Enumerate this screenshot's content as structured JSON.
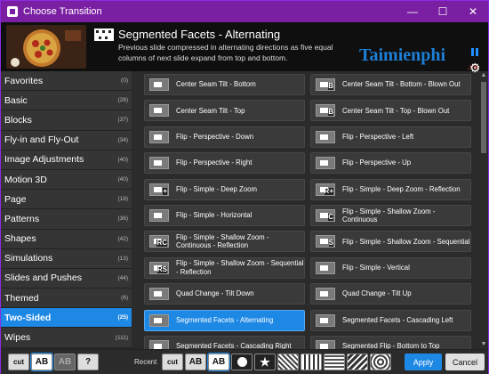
{
  "window": {
    "title": "Choose Transition",
    "minimize": "—",
    "maximize": "☐",
    "close": "✕"
  },
  "header": {
    "name": "Segmented Facets - Alternating",
    "description": "Previous slide compressed in alternating directions as five equal columns of next slide expand from top and bottom.",
    "watermark_brand": "Taimienphi",
    "watermark_tld": ".vn"
  },
  "sidebar": {
    "items": [
      {
        "label": "Favorites",
        "count": "(0)"
      },
      {
        "label": "Basic",
        "count": "(28)"
      },
      {
        "label": "Blocks",
        "count": "(37)"
      },
      {
        "label": "Fly-in and Fly-Out",
        "count": "(34)"
      },
      {
        "label": "Image Adjustments",
        "count": "(40)"
      },
      {
        "label": "Motion 3D",
        "count": "(40)"
      },
      {
        "label": "Page",
        "count": "(18)"
      },
      {
        "label": "Patterns",
        "count": "(36)"
      },
      {
        "label": "Shapes",
        "count": "(42)"
      },
      {
        "label": "Simulations",
        "count": "(13)"
      },
      {
        "label": "Slides and Pushes",
        "count": "(44)"
      },
      {
        "label": "Themed",
        "count": "(6)"
      },
      {
        "label": "Two-Sided",
        "count": "(25)",
        "selected": true
      },
      {
        "label": "Wipes",
        "count": "(111)"
      }
    ]
  },
  "transitions": [
    {
      "label": "Center Seam Tilt - Bottom",
      "badge": ""
    },
    {
      "label": "Center Seam Tilt - Bottom - Blown Out",
      "badge": "B"
    },
    {
      "label": "Center Seam Tilt - Top",
      "badge": ""
    },
    {
      "label": "Center Seam Tilt - Top - Blown Out",
      "badge": "B"
    },
    {
      "label": "Flip - Perspective - Down",
      "badge": ""
    },
    {
      "label": "Flip - Perspective - Left",
      "badge": ""
    },
    {
      "label": "Flip - Perspective - Right",
      "badge": ""
    },
    {
      "label": "Flip - Perspective - Up",
      "badge": ""
    },
    {
      "label": "Flip - Simple - Deep Zoom",
      "badge": "+"
    },
    {
      "label": "Flip - Simple - Deep Zoom - Reflection",
      "badge": "R+"
    },
    {
      "label": "Flip - Simple - Horizontal",
      "badge": ""
    },
    {
      "label": "Flip - Simple - Shallow Zoom - Continuous",
      "badge": "C"
    },
    {
      "label": "Flip - Simple - Shallow Zoom - Continuous - Reflection",
      "badge": "RC"
    },
    {
      "label": "Flip - Simple - Shallow Zoom - Sequential",
      "badge": "S"
    },
    {
      "label": "Flip - Simple - Shallow Zoom - Sequential - Reflection",
      "badge": "RS"
    },
    {
      "label": "Flip - Simple - Vertical",
      "badge": ""
    },
    {
      "label": "Quad Change - Tilt Down",
      "badge": ""
    },
    {
      "label": "Quad Change - Tilt Up",
      "badge": ""
    },
    {
      "label": "Segmented Facets - Alternating",
      "badge": "",
      "selected": true
    },
    {
      "label": "Segmented Facets - Cascading Left",
      "badge": ""
    },
    {
      "label": "Segmented Facets - Cascading Right",
      "badge": ""
    },
    {
      "label": "Segmented Flip - Bottom to Top",
      "badge": ""
    }
  ],
  "footer": {
    "mode_buttons": [
      "cut",
      "AB",
      "AB",
      "?"
    ],
    "recent_label": "Recent",
    "recent_buttons": [
      "cut",
      "AB",
      "AB"
    ],
    "apply": "Apply",
    "cancel": "Cancel"
  },
  "colors": {
    "titlebar": "#7a1fa2",
    "accent": "#1e88e5"
  },
  "icons": {
    "pause": "pause-icon",
    "settings": "gear-icon"
  }
}
